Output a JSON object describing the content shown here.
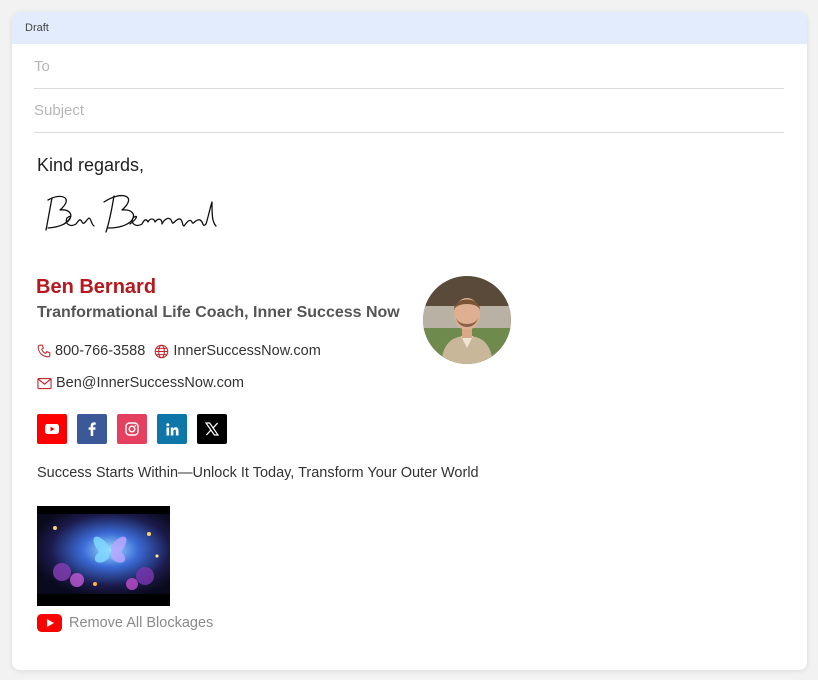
{
  "window": {
    "title": "Draft"
  },
  "compose": {
    "to_placeholder": "To",
    "subject_placeholder": "Subject"
  },
  "body": {
    "closing": "Kind regards,",
    "signature_name": "Ben Bernard"
  },
  "signature": {
    "name": "Ben Bernard",
    "title": "Tranformational Life Coach, Inner Success Now",
    "phone": "800-766-3588",
    "website": "InnerSuccessNow.com",
    "email": "Ben@InnerSuccessNow.com",
    "name_color": "#b5181d",
    "icon_color": "#c0272d",
    "socials": [
      {
        "name": "youtube",
        "icon": "youtube-icon",
        "color": "#ff0000"
      },
      {
        "name": "facebook",
        "icon": "facebook-icon",
        "color": "#3b5998"
      },
      {
        "name": "instagram",
        "icon": "instagram-icon",
        "color": "#e4405f"
      },
      {
        "name": "linkedin",
        "icon": "linkedin-icon",
        "color": "#0e76a8"
      },
      {
        "name": "x",
        "icon": "x-icon",
        "color": "#000000"
      }
    ],
    "tagline": "Success Starts Within—Unlock It Today, Transform Your Outer World",
    "video_label": "Remove All Blockages"
  },
  "colors": {
    "titlebar_bg": "#e3ecfc",
    "youtube_red": "#ff0000"
  }
}
